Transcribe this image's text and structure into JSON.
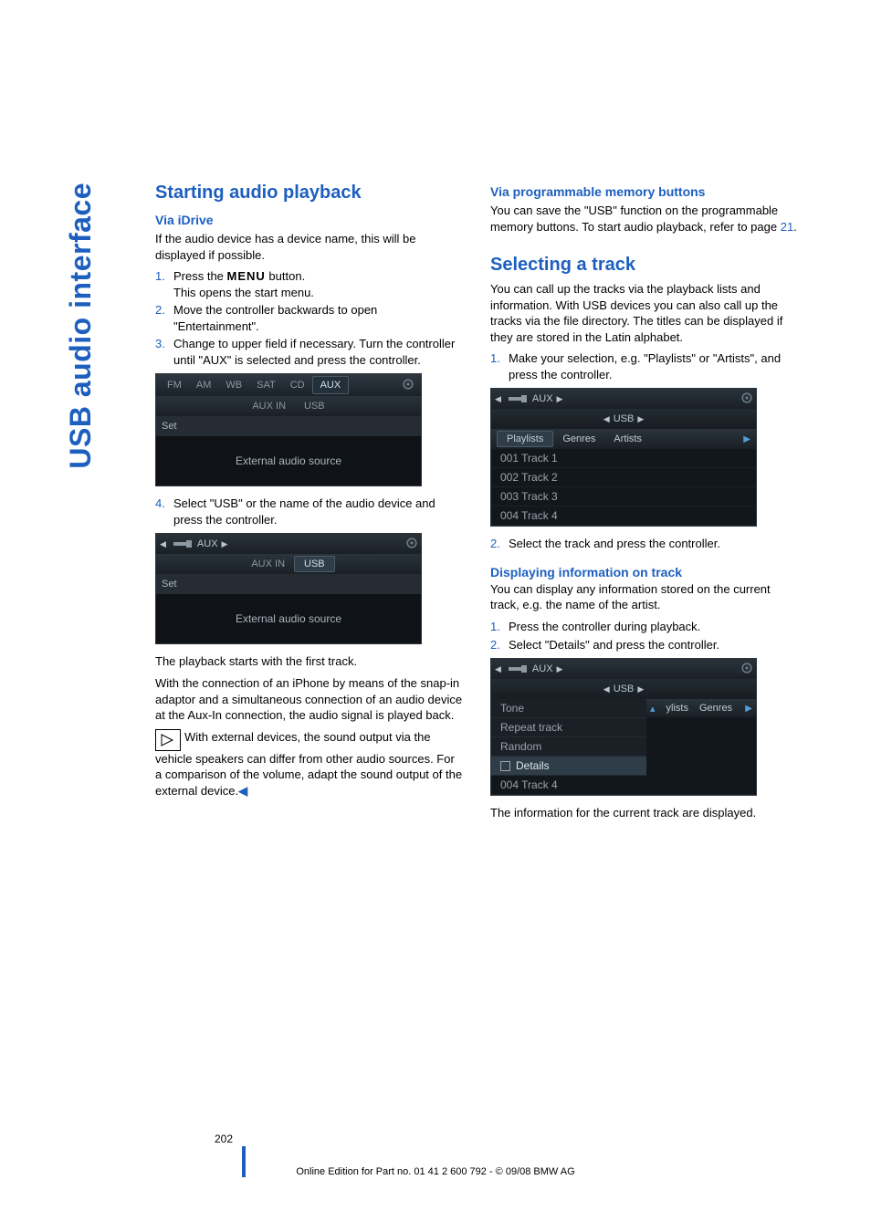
{
  "side_tab": "USB audio interface",
  "page_number": "202",
  "footer_line": "Online Edition for Part no. 01 41 2 600 792 - © 09/08 BMW AG",
  "left": {
    "h_start": "Starting audio playback",
    "h_via_idrive": "Via iDrive",
    "p_intro": "If the audio device has a device name, this will be displayed if possible.",
    "steps": [
      {
        "num": "1.",
        "text_a": "Press the ",
        "menu": "MENU",
        "text_b": " button.",
        "text_c": "This opens the start menu."
      },
      {
        "num": "2.",
        "text_a": "Move the controller backwards to open \"Entertainment\"."
      },
      {
        "num": "3.",
        "text_a": "Change to upper field if necessary. Turn the controller until \"AUX\" is selected and press the controller."
      }
    ],
    "screen1": {
      "tabs": [
        "FM",
        "AM",
        "WB",
        "SAT",
        "CD",
        "AUX"
      ],
      "sel_tab": 5,
      "mid": [
        "AUX IN",
        "USB"
      ],
      "set": "Set",
      "body": "External audio source"
    },
    "step4": {
      "num": "4.",
      "text": "Select \"USB\" or the name of the audio device and press the controller."
    },
    "screen2": {
      "nav_label": "AUX",
      "mid": [
        "AUX IN",
        "USB"
      ],
      "mid_sel": 1,
      "set": "Set",
      "body": "External audio source"
    },
    "p_playback": "The playback starts with the first track.",
    "p_iphone": "With the connection of an iPhone by means of the snap-in adaptor and a simultaneous connection of an audio device at the Aux-In connection, the audio signal is played back.",
    "note": "With external devices, the sound output via the vehicle speakers can differ from other audio sources. For a comparison of the volume, adapt the sound output of the external device."
  },
  "right": {
    "h_via_buttons": "Via programmable memory buttons",
    "p_buttons_a": "You can save the \"USB\" function on the programmable memory buttons. To start audio playback, refer to page ",
    "p_buttons_page": "21",
    "p_buttons_b": ".",
    "h_select": "Selecting a track",
    "p_select": "You can call up the tracks via the playback lists and information. With USB devices you can also call up the tracks via the file directory. The titles can be displayed if they are stored in the Latin alphabet.",
    "step1": {
      "num": "1.",
      "text": "Make your selection, e.g. \"Playlists\" or \"Artists\", and press the controller."
    },
    "screen3": {
      "nav1": "AUX",
      "nav2": "USB",
      "tabs": [
        "Playlists",
        "Genres",
        "Artists"
      ],
      "tabs_sel": 0,
      "tracks": [
        "001 Track 1",
        "002 Track 2",
        "003 Track 3",
        "004 Track 4"
      ]
    },
    "step2": {
      "num": "2.",
      "text": "Select the track and press the controller."
    },
    "h_display": "Displaying information on track",
    "p_display": "You can display any information stored on the current track, e.g. the name of the artist.",
    "dstep1": {
      "num": "1.",
      "text": "Press the controller during playback."
    },
    "dstep2": {
      "num": "2.",
      "text": "Select \"Details\" and press the controller."
    },
    "screen4": {
      "nav1": "AUX",
      "nav2": "USB",
      "tabs_right": [
        "ylists",
        "Genres"
      ],
      "menu": [
        "Tone",
        "Repeat track",
        "Random",
        "Details"
      ],
      "menu_sel": 3,
      "bottom": "004 Track 4"
    },
    "p_end": "The information for the current track are displayed."
  }
}
